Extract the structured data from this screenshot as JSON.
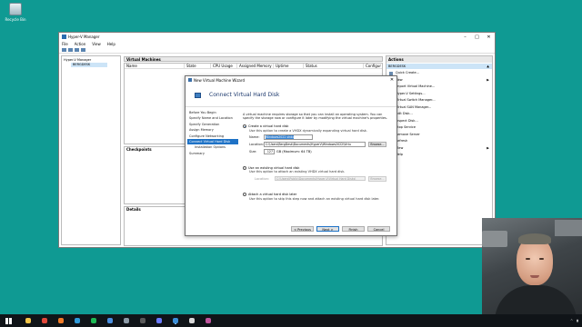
{
  "desktop": {
    "recycle_bin": "Recycle Bin"
  },
  "hyperv": {
    "title": "Hyper-V Manager",
    "menu": [
      "File",
      "Action",
      "View",
      "Help"
    ],
    "tree": {
      "root": "Hyper-V Manager",
      "host": "BERGDESK"
    },
    "vm_pane": {
      "title": "Virtual Machines",
      "columns": [
        "Name",
        "State",
        "CPU Usage",
        "Assigned Memory",
        "Uptime",
        "Status",
        "Configur"
      ]
    },
    "checkpoints_title": "Checkpoints",
    "details_title": "Details",
    "actions": {
      "title": "Actions",
      "host": "BERGDESK",
      "items": [
        "Quick Create...",
        "New",
        "Import Virtual Machine...",
        "Hyper-V Settings...",
        "Virtual Switch Manager...",
        "Virtual SAN Manager...",
        "Edit Disk...",
        "Inspect Disk...",
        "Stop Service",
        "Remove Server",
        "Refresh",
        "View",
        "Help"
      ]
    }
  },
  "wizard": {
    "title": "New Virtual Machine Wizard",
    "heading": "Connect Virtual Hard Disk",
    "close": "✕",
    "nav": [
      "Before You Begin",
      "Specify Name and Location",
      "Specify Generation",
      "Assign Memory",
      "Configure Networking",
      "Connect Virtual Hard Disk",
      "Installation Options",
      "Summary"
    ],
    "current_step_index": 5,
    "intro": "A virtual machine requires storage so that you can install an operating system. You can specify the storage now or configure it later by modifying the virtual machine's properties.",
    "create": {
      "label": "Create a virtual hard disk",
      "desc": "Use this option to create a VHDX dynamically expanding virtual hard disk.",
      "name_label": "Name:",
      "name_value": "Windows2022.vhdx",
      "location_label": "Location:",
      "location_value": "C:\\Users\\BergDesk\\Documents\\HyperV\\Windows2022\\Virtu",
      "browse": "Browse...",
      "size_label": "Size:",
      "size_value": "127",
      "size_unit": "GB (Maximum: 64 TB)"
    },
    "existing": {
      "label": "Use an existing virtual hard disk",
      "desc": "Use this option to attach an existing VHDX virtual hard disk.",
      "location_label": "Location:",
      "location_value": "C:\\Users\\Public\\Documents\\Hyper-V\\Virtual Hard Disks\\",
      "browse": "Browse..."
    },
    "later": {
      "label": "Attach a virtual hard disk later",
      "desc": "Use this option to skip this step now and attach an existing virtual hard disk later."
    },
    "buttons": {
      "previous": "< Previous",
      "next": "Next >",
      "finish": "Finish",
      "cancel": "Cancel"
    }
  },
  "taskbar": {
    "icons": [
      "file-explorer-icon",
      "chrome-icon",
      "firefox-icon",
      "edge-icon",
      "spotify-icon",
      "mail-icon",
      "settings-icon",
      "obs-icon",
      "camera-icon",
      "hyperv-icon",
      "terminal-icon",
      "photos-icon"
    ],
    "icon_colors": [
      "#f3c64a",
      "#e0483a",
      "#f07b28",
      "#2f9ad9",
      "#1db954",
      "#4a8fe0",
      "#8c9aa6",
      "#5a5a5a",
      "#6b7bff",
      "#3c8fd8",
      "#d8d8d8",
      "#c0569e"
    ]
  }
}
